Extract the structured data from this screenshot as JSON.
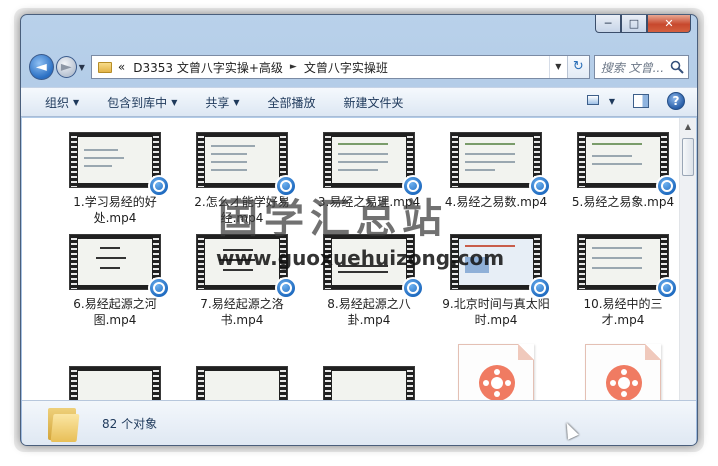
{
  "window": {
    "caption_min": "─",
    "caption_max": "□",
    "caption_close": "✕"
  },
  "nav": {
    "back_glyph": "◄",
    "forward_glyph": "►",
    "address": {
      "overflow": "«",
      "crumbs": [
        "D3353 文曾八字实操+高级",
        "文曾八字实操班"
      ],
      "separator": "►"
    },
    "search_placeholder": "搜索 文曾..."
  },
  "toolbar": {
    "organize": "组织",
    "include_library": "包含到库中",
    "share": "共享",
    "play_all": "全部播放",
    "new_folder": "新建文件夹"
  },
  "files": [
    {
      "name": "1.学习易经的好处.mp4"
    },
    {
      "name": "2.怎么才能学好易经.mp4"
    },
    {
      "name": "3.易经之易理.mp4"
    },
    {
      "name": "4.易经之易数.mp4"
    },
    {
      "name": "5.易经之易象.mp4"
    },
    {
      "name": "6.易经起源之河图.mp4"
    },
    {
      "name": "7.易经起源之洛书.mp4"
    },
    {
      "name": "8.易经起源之八卦.mp4"
    },
    {
      "name": "9.北京时间与真太阳时.mp4"
    },
    {
      "name": "10.易经中的三才.mp4"
    }
  ],
  "status": {
    "count": "82 个对象"
  },
  "watermark": {
    "title": "国学汇总站",
    "url": "www.guoxuehuizong.com"
  },
  "icons": [
    "folder-icon",
    "back-arrow-icon",
    "forward-arrow-icon",
    "refresh-icon",
    "search-icon",
    "view-icon",
    "preview-pane-icon",
    "help-icon",
    "video-file-icon"
  ]
}
